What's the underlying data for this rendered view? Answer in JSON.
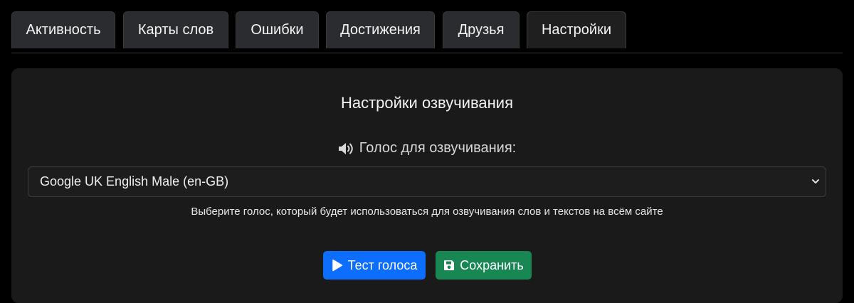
{
  "tabs": [
    {
      "label": "Активность",
      "active": false
    },
    {
      "label": "Карты слов",
      "active": false
    },
    {
      "label": "Ошибки",
      "active": false
    },
    {
      "label": "Достижения",
      "active": false
    },
    {
      "label": "Друзья",
      "active": false
    },
    {
      "label": "Настройки",
      "active": true
    }
  ],
  "panel": {
    "title": "Настройки озвучивания",
    "voice_label": "Голос для озвучивания:",
    "voice_icon": "volume-icon",
    "selected_voice": "Google UK English Male (en-GB)",
    "hint": "Выберите голос, который будет использоваться для озвучивания слов и текстов на всём сайте",
    "test_button": {
      "label": "Тест голоса",
      "icon": "play-icon",
      "color": "#0d6efd"
    },
    "save_button": {
      "label": "Сохранить",
      "icon": "floppy-disk-icon",
      "color": "#198754"
    }
  }
}
